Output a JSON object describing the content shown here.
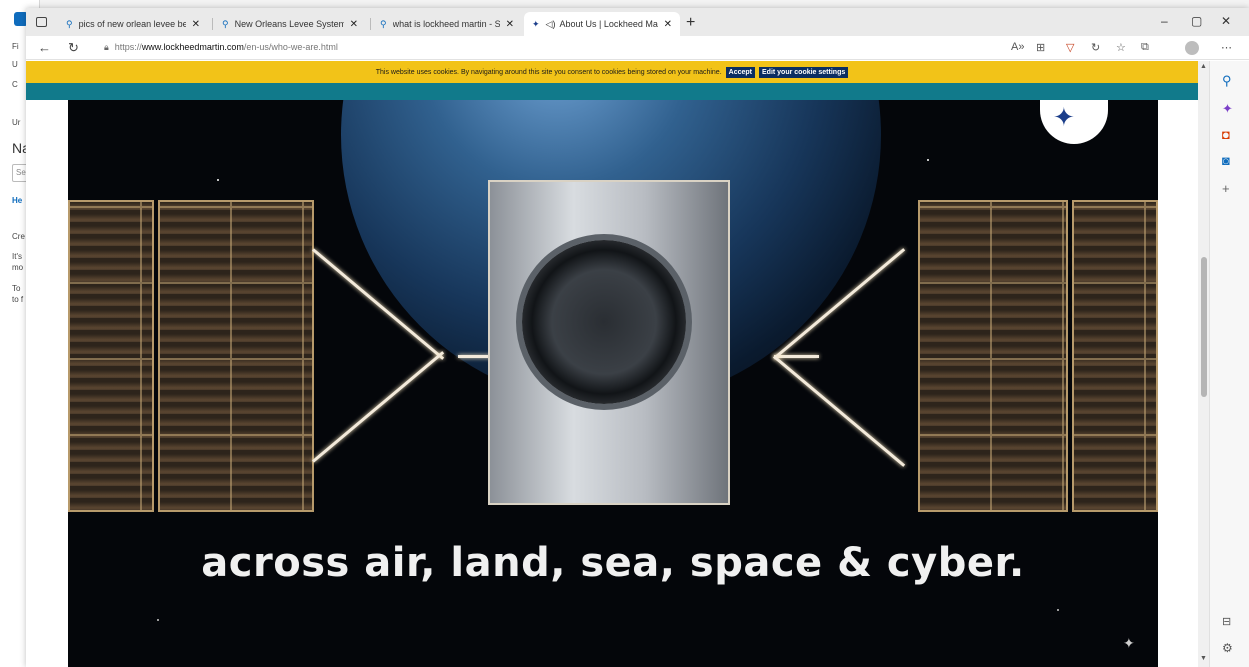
{
  "background_app": {
    "lines": [
      "Fi",
      "U",
      "C",
      "Ur",
      "Na",
      "Se",
      "He",
      "Cre",
      "It's",
      "mo",
      "To",
      "to f"
    ]
  },
  "browser": {
    "tabs": [
      {
        "icon": "search-icon",
        "label": "pics of new orlean levee before",
        "active": false
      },
      {
        "icon": "search-icon",
        "label": "New Orleans Levee System Map",
        "active": false
      },
      {
        "icon": "search-icon",
        "label": "what is lockheed martin - Search",
        "active": false
      },
      {
        "icon": "lockheed-star-icon",
        "label": "About Us | Lockheed Martin",
        "active": true
      }
    ],
    "new_tab": "+",
    "window_controls": {
      "minimize": "–",
      "maximize": "▢",
      "close": "✕"
    },
    "url_prefix": "https://",
    "url_host": "www.lockheedmartin.com",
    "url_path": "/en-us/who-we-are.html"
  },
  "cookie_banner": {
    "message": "This website uses cookies. By navigating around this site you consent to cookies being stored on your machine.",
    "accept_label": "Accept",
    "settings_label": "Edit your cookie settings",
    "background_color": "#f2c318"
  },
  "hero": {
    "caption": "across air, land, sea, space & cyber.",
    "accent_strip_color": "#117a8b",
    "logo_color": "#1c3e8a"
  },
  "sidebar": {
    "icons": [
      "search-icon",
      "sparkle-icon",
      "office-icon",
      "outlook-icon",
      "add-icon"
    ],
    "bottom_icons": [
      "sidebar-toggle-icon",
      "settings-icon"
    ]
  }
}
